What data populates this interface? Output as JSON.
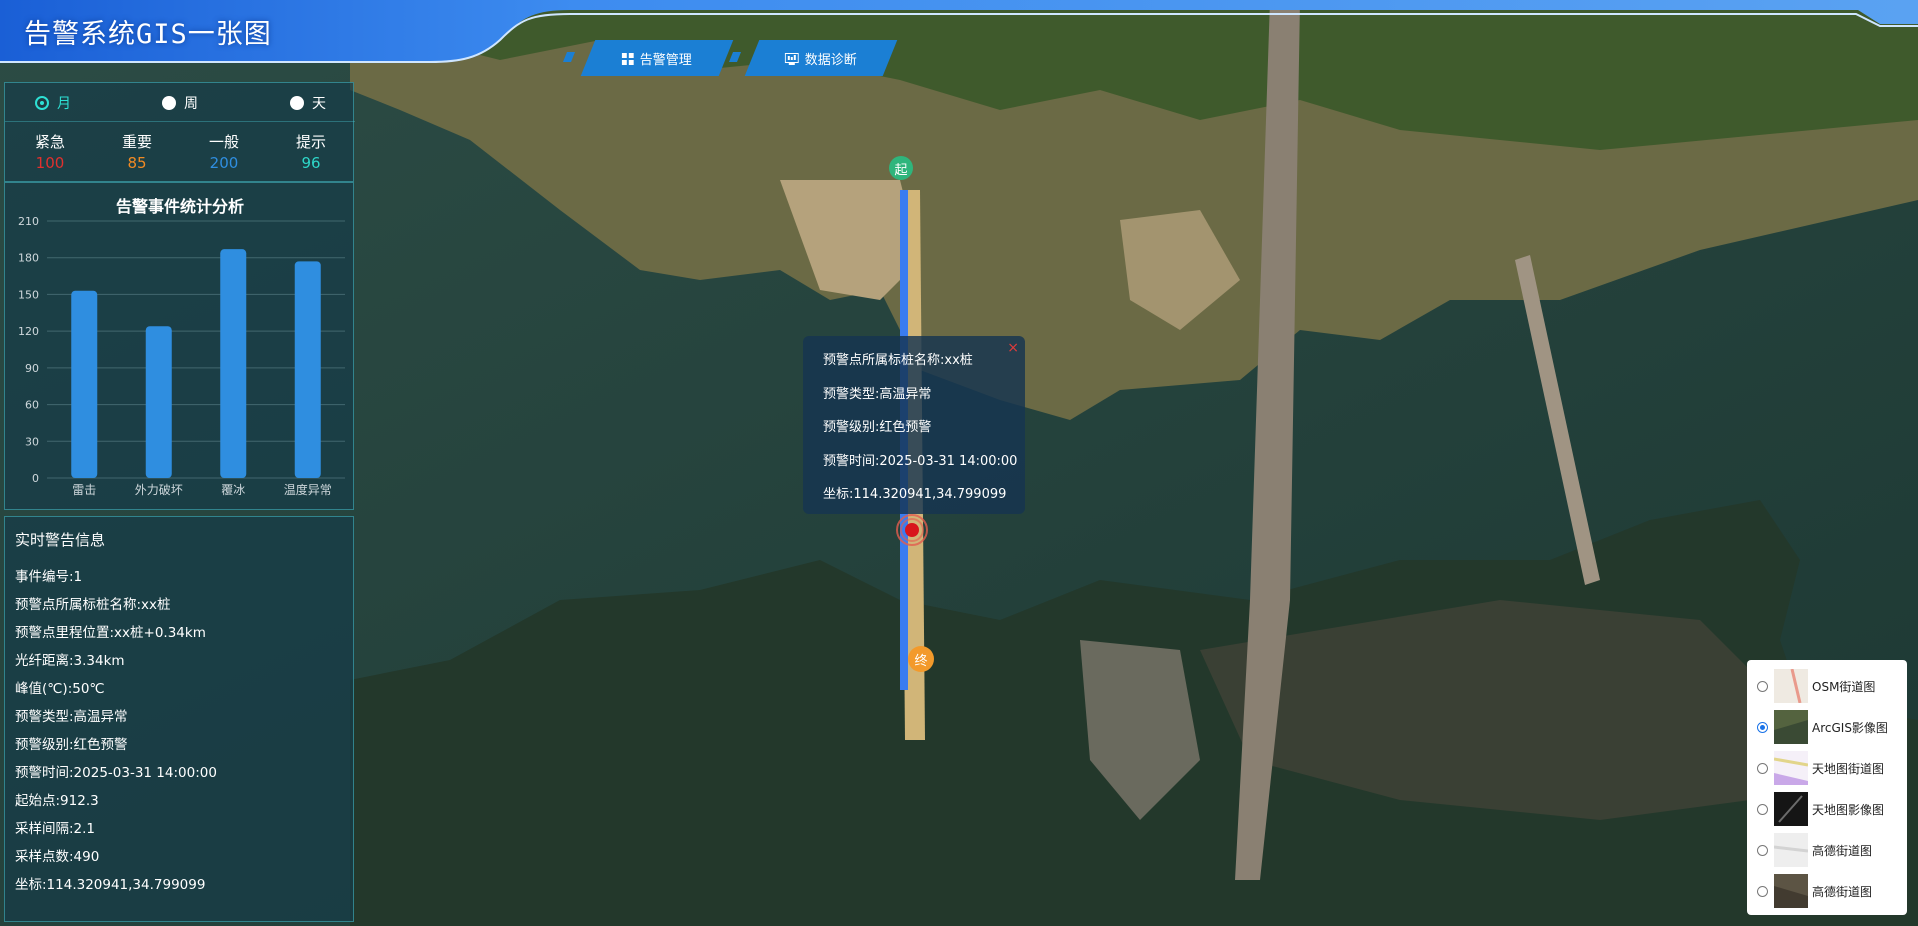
{
  "header": {
    "title": "告警系统GIS一张图",
    "tabs": [
      {
        "label": "告警管理",
        "icon": "grid-icon"
      },
      {
        "label": "数据诊断",
        "icon": "monitor-icon"
      }
    ]
  },
  "period_filter": {
    "options": [
      {
        "label": "月",
        "selected": true
      },
      {
        "label": "周",
        "selected": false
      },
      {
        "label": "天",
        "selected": false
      }
    ]
  },
  "levels": [
    {
      "name": "紧急",
      "value": "100",
      "color": "#e0302e"
    },
    {
      "name": "重要",
      "value": "85",
      "color": "#f08a24"
    },
    {
      "name": "一般",
      "value": "200",
      "color": "#2f8ee0"
    },
    {
      "name": "提示",
      "value": "96",
      "color": "#2ed6c8"
    }
  ],
  "chart_data": {
    "type": "bar",
    "title": "告警事件统计分析",
    "categories": [
      "雷击",
      "外力破坏",
      "覆冰",
      "温度异常"
    ],
    "values": [
      153,
      124,
      187,
      177
    ],
    "y_ticks": [
      "0",
      "30",
      "60",
      "90",
      "120",
      "150",
      "180",
      "210"
    ],
    "ylim": [
      0,
      210
    ],
    "xlabel": "",
    "ylabel": "",
    "grid": true,
    "bar_color": "#2f8ee0"
  },
  "realtime": {
    "title": "实时警告信息",
    "lines": [
      "事件编号:1",
      "预警点所属标桩名称:xx桩",
      "预警点里程位置:xx桩+0.34km",
      "光纤距离:3.34km",
      "峰值(℃):50℃",
      "预警类型:高温异常",
      "预警级别:红色预警",
      "预警时间:2025-03-31 14:00:00",
      "起始点:912.3",
      "采样间隔:2.1",
      "采样点数:490",
      "坐标:114.320941,34.799099"
    ]
  },
  "popup": {
    "close": "×",
    "lines": [
      "预警点所属标桩名称:xx桩",
      "预警类型:高温异常",
      "预警级别:红色预警",
      "预警时间:2025-03-31 14:00:00",
      "坐标:114.320941,34.799099"
    ]
  },
  "markers": {
    "start": "起",
    "end": "终"
  },
  "layers": [
    {
      "label": "OSM街道图",
      "selected": false,
      "thumb": "street"
    },
    {
      "label": "ArcGIS影像图",
      "selected": true,
      "thumb": "satellite"
    },
    {
      "label": "天地图街道图",
      "selected": false,
      "thumb": "street-pink"
    },
    {
      "label": "天地图影像图",
      "selected": false,
      "thumb": "dark-satellite"
    },
    {
      "label": "高德街道图",
      "selected": false,
      "thumb": "light-street"
    },
    {
      "label": "高德街道图",
      "selected": false,
      "thumb": "satellite"
    }
  ]
}
